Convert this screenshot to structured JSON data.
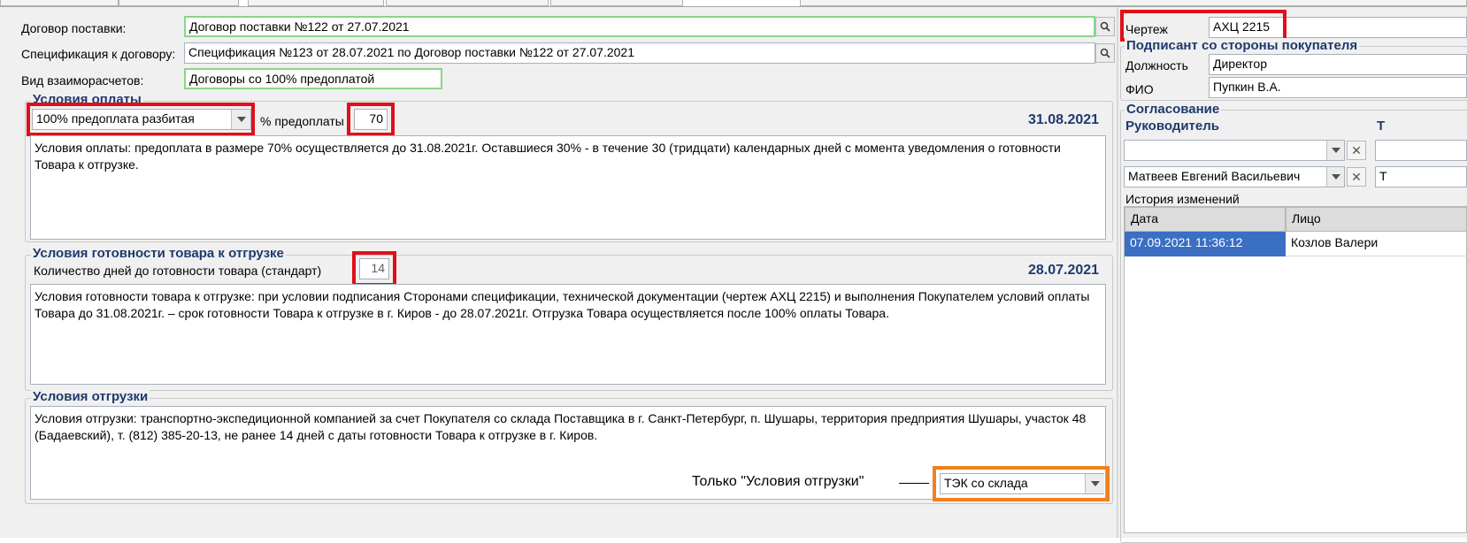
{
  "contract": {
    "label": "Договор поставки:",
    "value": "Договор поставки №122 от 27.07.2021"
  },
  "spec": {
    "label": "Спецификация к договору:",
    "value": "Спецификация №123 от 28.07.2021 по Договор поставки №122 от 27.07.2021"
  },
  "settlement": {
    "label": "Вид взаиморасчетов:",
    "value": "Договоры со 100% предоплатой"
  },
  "payment": {
    "title": "Условия оплаты",
    "type_value": "100% предоплата разбитая",
    "percent_label": "% предоплаты",
    "percent_value": "70",
    "date": "31.08.2021",
    "text": "Условия оплаты: предоплата в размере 70% осуществляется до 31.08.2021г. Оставшиеся 30% - в течение 30 (тридцати) календарных дней с момента уведомления о готовности Товара к отгрузке."
  },
  "readiness": {
    "title": "Условия готовности товара к отгрузке",
    "days_label": "Количество дней до готовности товара (стандарт)",
    "days_value": "14",
    "date": "28.07.2021",
    "text": "Условия готовности товара к отгрузке: при условии подписания Сторонами спецификации, технической документации (чертеж АХЦ 2215) и выполнения Покупателем условий оплаты Товара до 31.08.2021г. – срок готовности Товара к отгрузке в г. Киров - до 28.07.2021г. Отгрузка Товара осуществляется после 100% оплаты Товара."
  },
  "shipping": {
    "title": "Условия отгрузки",
    "text": "Условия отгрузки: транспортно-экспедиционной компанией за счет Покупателя со склада Поставщика в г. Санкт-Петербург, п. Шушары, территория предприятия Шушары, участок 48 (Бадаевский), т. (812) 385-20-13, не ранее 14 дней с даты готовности Товара к отгрузке в г. Киров.",
    "annotation": "Только \"Условия отгрузки\"",
    "method_value": "ТЭК со склада"
  },
  "drawing": {
    "label": "Чертеж",
    "value": "АХЦ 2215"
  },
  "signer": {
    "title": "Подписант со стороны покупателя",
    "position_label": "Должность",
    "position_value": "Директор",
    "name_label": "ФИО",
    "name_value": "Пупкин В.А."
  },
  "approval": {
    "title": "Согласование",
    "col_head": "Руководитель",
    "col_head2": "Т",
    "row1_value": "",
    "row2_value": "Матвеев Евгений Васильевич",
    "row2_extra": "Т",
    "history_label": "История изменений",
    "grid_headers": [
      "Дата",
      "Лицо"
    ],
    "grid_rows": [
      [
        "07.09.2021 11:36:12",
        "Козлов Валери"
      ]
    ]
  },
  "colors": {
    "highlight_red": "#e0101a",
    "highlight_orange": "#f08020",
    "title_blue": "#1e3a6e",
    "selected_row": "#3a6fc4"
  }
}
